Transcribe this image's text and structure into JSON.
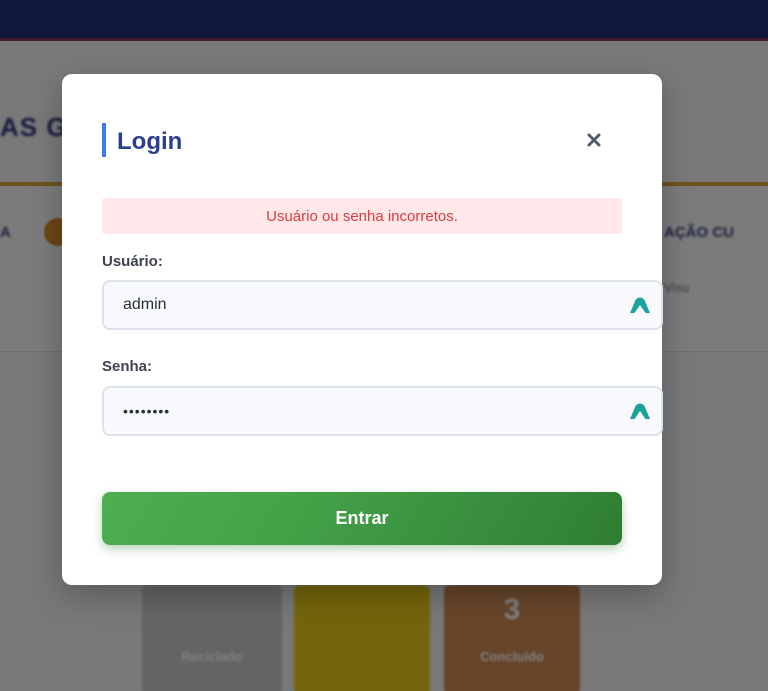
{
  "background": {
    "header_title": "AS GU",
    "nav_left": "A",
    "nav_right": "AÇÃO CU",
    "nav_right_sub": "Visu",
    "cards": [
      {
        "number": "",
        "label": "Reciclado"
      },
      {
        "number": "",
        "label": ""
      },
      {
        "number": "3",
        "label": "Concluído"
      }
    ]
  },
  "modal": {
    "title": "Login",
    "close_icon": "close-icon",
    "error_message": "Usuário ou senha incorretos.",
    "username": {
      "label": "Usuário:",
      "value": "admin",
      "icon": "password-manager-icon"
    },
    "password": {
      "label": "Senha:",
      "value": "••••••••",
      "icon": "password-manager-icon"
    },
    "submit_label": "Entrar"
  },
  "colors": {
    "accent_blue": "#3f7de6",
    "title_blue": "#2c3f8f",
    "error_text": "#d83e3e",
    "error_bg": "#ffe7ea",
    "button_green": "#43a047",
    "icon_teal": "#1aa39a"
  }
}
